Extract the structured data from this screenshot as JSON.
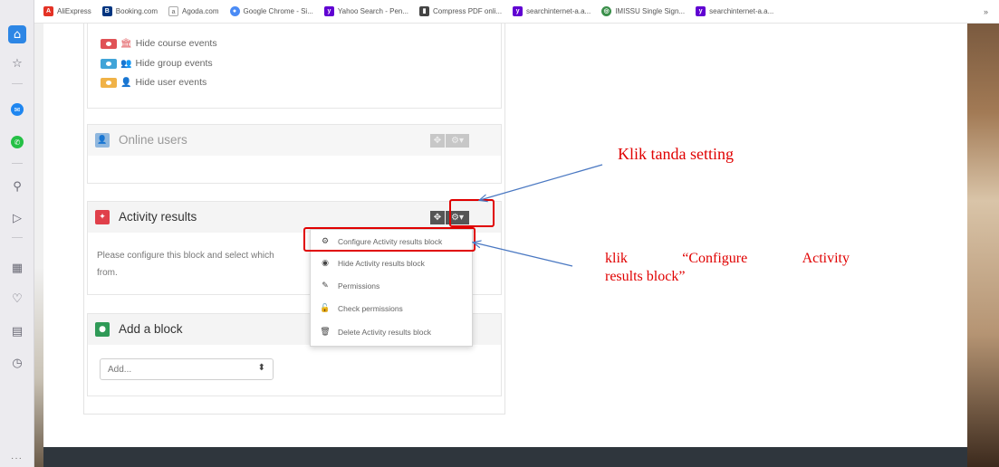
{
  "bookmarks": [
    {
      "label": "AliExpress",
      "icon": "aliexpress-icon",
      "color": "#e43225"
    },
    {
      "label": "Booking.com",
      "icon": "booking-icon",
      "color": "#003580"
    },
    {
      "label": "Agoda.com",
      "icon": "agoda-icon",
      "color": "#888888"
    },
    {
      "label": "Google Chrome - Si...",
      "icon": "chrome-icon",
      "color": "#4b8bf5"
    },
    {
      "label": "Yahoo Search - Pen...",
      "icon": "yahoo-icon",
      "color": "#6001d2"
    },
    {
      "label": "Compress PDF onli...",
      "icon": "pdf-icon",
      "color": "#444444"
    },
    {
      "label": "searchinternet-a.a...",
      "icon": "yahoo-icon",
      "color": "#6001d2"
    },
    {
      "label": "IMISSU Single Sign...",
      "icon": "imissu-icon",
      "color": "#3a8f4a"
    },
    {
      "label": "searchinternet-a.a...",
      "icon": "yahoo-icon",
      "color": "#6001d2"
    }
  ],
  "bookmarks_more": "»",
  "calendar_legend": [
    {
      "label": "Hide course events",
      "icon": "bank-icon",
      "color": "#e05256"
    },
    {
      "label": "Hide group events",
      "icon": "group-icon",
      "color": "#40a4d8"
    },
    {
      "label": "Hide user events",
      "icon": "user-icon",
      "color": "#f0b247"
    }
  ],
  "online_users": {
    "title": "Online users",
    "icon_color": "#8fb7de"
  },
  "activity_results": {
    "title": "Activity results",
    "icon_color": "#e0404a",
    "text_line1": "Please configure this block and select which",
    "text_line2": "from."
  },
  "add_block": {
    "title": "Add a block",
    "icon_color": "#2f9a57",
    "select_value": "Add..."
  },
  "menu": [
    {
      "label": "Configure Activity results block",
      "icon": "gear-icon"
    },
    {
      "label": "Hide Activity results block",
      "icon": "eye-icon"
    },
    {
      "label": "Permissions",
      "icon": "edit-icon"
    },
    {
      "label": "Check permissions",
      "icon": "unlock-icon"
    },
    {
      "label": "Delete Activity results block",
      "icon": "trash-icon"
    }
  ],
  "annotations": {
    "note1": "Klik tanda setting",
    "note2_w1": "klik",
    "note2_w2": "“Configure",
    "note2_w3": "Activity",
    "note2_line2": "results block”"
  },
  "colors": {
    "annotation": "#e00000",
    "arrow": "#4a78c2",
    "footer": "#2f363d"
  }
}
